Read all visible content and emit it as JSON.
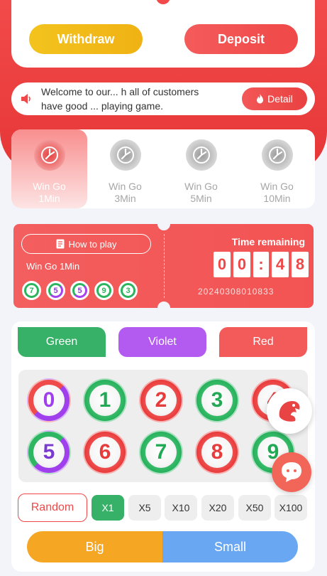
{
  "wallet": {
    "withdraw_label": "Withdraw",
    "deposit_label": "Deposit"
  },
  "notice": {
    "line1": "Welcome to our... h all of customers",
    "line2": "have good ... playing game.",
    "detail_label": "Detail"
  },
  "games": [
    {
      "name": "Win Go",
      "duration": "1Min",
      "active": true
    },
    {
      "name": "Win Go",
      "duration": "3Min",
      "active": false
    },
    {
      "name": "Win Go",
      "duration": "5Min",
      "active": false
    },
    {
      "name": "Win Go",
      "duration": "10Min",
      "active": false
    }
  ],
  "timer": {
    "how_to_play_label": "How to play",
    "game_name": "Win Go 1Min",
    "recent_results": [
      "7",
      "5",
      "5",
      "9",
      "3"
    ],
    "time_remaining_label": "Time remaining",
    "countdown": [
      "0",
      "0",
      ":",
      "4",
      "8"
    ],
    "period": "20240308010833"
  },
  "colors": {
    "green_label": "Green",
    "violet_label": "Violet",
    "red_label": "Red"
  },
  "numbers": [
    "0",
    "1",
    "2",
    "3",
    "4",
    "5",
    "6",
    "7",
    "8",
    "9"
  ],
  "multipliers": {
    "random_label": "Random",
    "options": [
      "X1",
      "X5",
      "X10",
      "X20",
      "X50",
      "X100"
    ],
    "selected": "X1"
  },
  "size": {
    "big_label": "Big",
    "small_label": "Small"
  },
  "theme": {
    "red": "#f04848",
    "green": "#37b167",
    "violet": "#b35af1",
    "yellow": "#f3c31d",
    "blue": "#6aa7f3"
  }
}
